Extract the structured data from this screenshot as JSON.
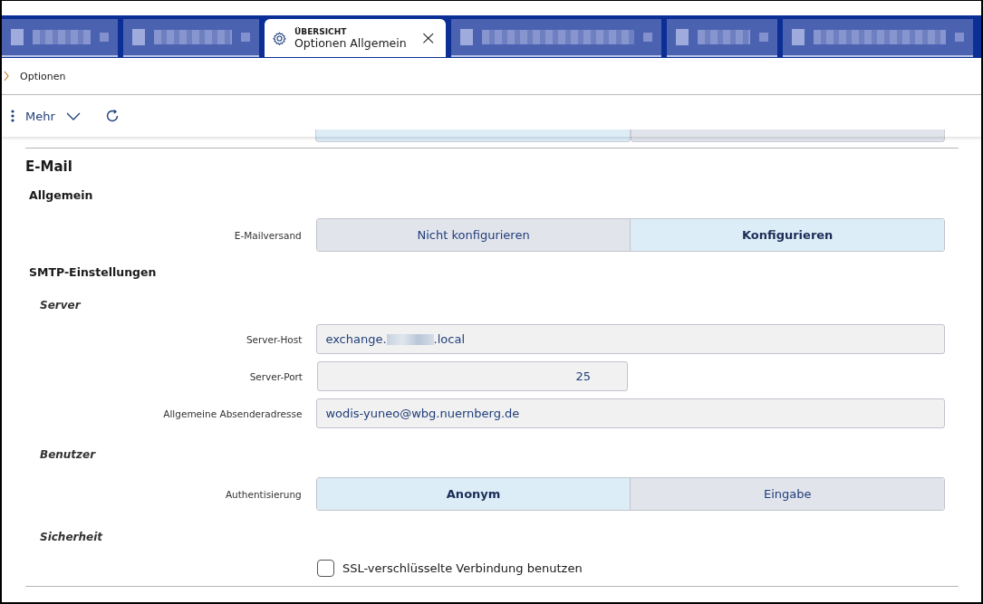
{
  "tabs": [
    {
      "kind": "blurred",
      "selected": false
    },
    {
      "kind": "blurred",
      "selected": false
    },
    {
      "kind": "normal",
      "eyebrow": "ÜBERSICHT",
      "title": "Optionen Allgemein",
      "close": "×",
      "selected": true
    },
    {
      "kind": "blurred",
      "selected": false
    },
    {
      "kind": "blurred",
      "selected": false
    },
    {
      "kind": "blurred",
      "selected": false
    }
  ],
  "breadcrumb": "Optionen",
  "toolbar": {
    "more": "Mehr"
  },
  "section": "E-Mail",
  "groups": [
    {
      "title": "Allgemein",
      "rows": [
        {
          "kind": "segmented",
          "label": "E-Mailversand",
          "options": [
            {
              "label": "Nicht konfigurieren",
              "selected": false
            },
            {
              "label": "Konfigurieren",
              "selected": true
            }
          ]
        }
      ]
    },
    {
      "title": "SMTP-Einstellungen",
      "rows": [
        {
          "kind": "subheading",
          "title": "Server"
        },
        {
          "kind": "text",
          "label": "Server-Host",
          "value_start": "exchange.",
          "redacted": true,
          "value_end": ".local"
        },
        {
          "kind": "number",
          "label": "Server-Port",
          "value": "25"
        },
        {
          "kind": "text",
          "label": "Allgemeine Absenderadresse",
          "value_start": "wodis-yuneo@wbg.nuernberg.de"
        },
        {
          "kind": "subheading",
          "title": "Benutzer"
        },
        {
          "kind": "segmented",
          "label": "Authentisierung",
          "options": [
            {
              "label": "Anonym",
              "selected": true
            },
            {
              "label": "Eingabe",
              "selected": false
            }
          ]
        },
        {
          "kind": "subheading",
          "title": "Sicherheit"
        },
        {
          "kind": "checkbox",
          "label": "SSL-verschlüsselte Verbindung benutzen",
          "checked": false
        }
      ]
    }
  ]
}
